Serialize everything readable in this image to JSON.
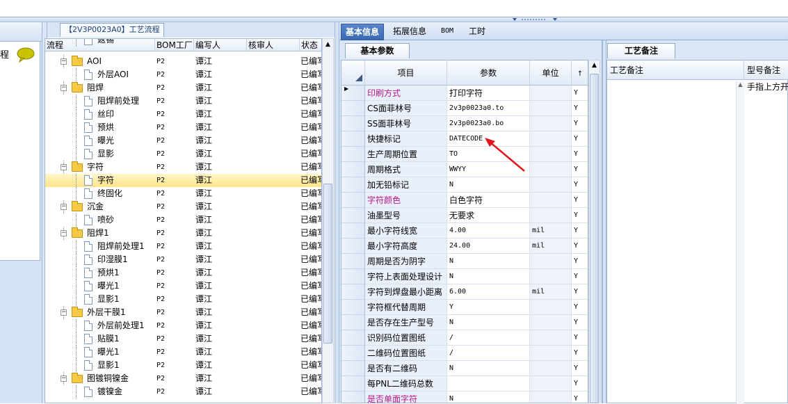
{
  "left_panel": {
    "header_text": "程"
  },
  "tree_panel": {
    "tab_title": "【2V3P0023A0】工艺流程",
    "columns": [
      "流程",
      "BOM工厂",
      "编写人",
      "核审人",
      "状态"
    ],
    "rows": [
      {
        "level": 1,
        "type": "doc",
        "name": "返锡",
        "bom": "",
        "writer": "",
        "reviewer": "",
        "status": ""
      },
      {
        "level": 0,
        "type": "folder",
        "name": "AOI",
        "bom": "P2",
        "writer": "谭江",
        "reviewer": "",
        "status": "已编写"
      },
      {
        "level": 1,
        "type": "doc",
        "name": "外层AOI",
        "bom": "P2",
        "writer": "谭江",
        "reviewer": "",
        "status": "已编写"
      },
      {
        "level": 0,
        "type": "folder",
        "name": "阻焊",
        "bom": "P2",
        "writer": "谭江",
        "reviewer": "",
        "status": "已编写"
      },
      {
        "level": 1,
        "type": "doc",
        "name": "阻焊前处理",
        "bom": "P2",
        "writer": "谭江",
        "reviewer": "",
        "status": "已编写"
      },
      {
        "level": 1,
        "type": "doc",
        "name": "丝印",
        "bom": "P2",
        "writer": "谭江",
        "reviewer": "",
        "status": "已编写"
      },
      {
        "level": 1,
        "type": "doc",
        "name": "预烘",
        "bom": "P2",
        "writer": "谭江",
        "reviewer": "",
        "status": "已编写"
      },
      {
        "level": 1,
        "type": "doc",
        "name": "曝光",
        "bom": "P2",
        "writer": "谭江",
        "reviewer": "",
        "status": "已编写"
      },
      {
        "level": 1,
        "type": "doc",
        "name": "显影",
        "bom": "P2",
        "writer": "谭江",
        "reviewer": "",
        "status": "已编写"
      },
      {
        "level": 0,
        "type": "folder",
        "name": "字符",
        "bom": "P2",
        "writer": "谭江",
        "reviewer": "",
        "status": "已编写"
      },
      {
        "level": 1,
        "type": "doc",
        "name": "字符",
        "bom": "P2",
        "writer": "谭江",
        "reviewer": "",
        "status": "已编写",
        "selected": true
      },
      {
        "level": 1,
        "type": "doc",
        "name": "终固化",
        "bom": "P2",
        "writer": "谭江",
        "reviewer": "",
        "status": "已编写"
      },
      {
        "level": 0,
        "type": "folder",
        "name": "沉金",
        "bom": "P2",
        "writer": "谭江",
        "reviewer": "",
        "status": "已编写"
      },
      {
        "level": 1,
        "type": "doc",
        "name": "喷砂",
        "bom": "P2",
        "writer": "谭江",
        "reviewer": "",
        "status": "已编写"
      },
      {
        "level": 0,
        "type": "folder",
        "name": "阻焊1",
        "bom": "P2",
        "writer": "谭江",
        "reviewer": "",
        "status": "已编写"
      },
      {
        "level": 1,
        "type": "doc",
        "name": "阻焊前处理1",
        "bom": "P2",
        "writer": "谭江",
        "reviewer": "",
        "status": "已编写"
      },
      {
        "level": 1,
        "type": "doc",
        "name": "印湿膜1",
        "bom": "P2",
        "writer": "谭江",
        "reviewer": "",
        "status": "已编写"
      },
      {
        "level": 1,
        "type": "doc",
        "name": "预烘1",
        "bom": "P2",
        "writer": "谭江",
        "reviewer": "",
        "status": "已编写"
      },
      {
        "level": 1,
        "type": "doc",
        "name": "曝光1",
        "bom": "P2",
        "writer": "谭江",
        "reviewer": "",
        "status": "已编写"
      },
      {
        "level": 1,
        "type": "doc",
        "name": "显影1",
        "bom": "P2",
        "writer": "谭江",
        "reviewer": "",
        "status": "已编写"
      },
      {
        "level": 0,
        "type": "folder",
        "name": "外层干膜1",
        "bom": "P2",
        "writer": "谭江",
        "reviewer": "",
        "status": "已编写"
      },
      {
        "level": 1,
        "type": "doc",
        "name": "外层前处理1",
        "bom": "P2",
        "writer": "谭江",
        "reviewer": "",
        "status": "已编写"
      },
      {
        "level": 1,
        "type": "doc",
        "name": "贴膜1",
        "bom": "P2",
        "writer": "谭江",
        "reviewer": "",
        "status": "已编写"
      },
      {
        "level": 1,
        "type": "doc",
        "name": "曝光1",
        "bom": "P2",
        "writer": "谭江",
        "reviewer": "",
        "status": "已编写"
      },
      {
        "level": 1,
        "type": "doc",
        "name": "显影1",
        "bom": "P2",
        "writer": "谭江",
        "reviewer": "",
        "status": "已编写"
      },
      {
        "level": 0,
        "type": "folder",
        "name": "图镀铜镍金",
        "bom": "P2",
        "writer": "谭江",
        "reviewer": "",
        "status": "已编写"
      },
      {
        "level": 1,
        "type": "doc",
        "name": "镀镍金",
        "bom": "P2",
        "writer": "谭江",
        "reviewer": "",
        "status": "已编写"
      }
    ]
  },
  "main_tabs": [
    "基本信息",
    "拓展信息",
    "BOM",
    "工时"
  ],
  "basic_params": {
    "tab_label": "基本参数",
    "columns": [
      "项目",
      "参数",
      "单位",
      ""
    ],
    "rows": [
      {
        "item": "印刷方式",
        "value": "打印字符",
        "unit": "",
        "flag": "Y",
        "highlight": true,
        "current": true
      },
      {
        "item": "CS面菲林号",
        "value": "2v3p0023a0.to",
        "unit": "",
        "flag": "Y"
      },
      {
        "item": "SS面菲林号",
        "value": "2v3p0023a0.bo",
        "unit": "",
        "flag": "Y"
      },
      {
        "item": "快捷标记",
        "value": "DATECODE",
        "unit": "",
        "flag": "Y"
      },
      {
        "item": "生产周期位置",
        "value": "TO",
        "unit": "",
        "flag": "Y"
      },
      {
        "item": "周期格式",
        "value": "WWYY",
        "unit": "",
        "flag": "Y"
      },
      {
        "item": "加无铅标记",
        "value": "N",
        "unit": "",
        "flag": "Y"
      },
      {
        "item": "字符颜色",
        "value": "白色字符",
        "unit": "",
        "flag": "Y",
        "highlight": true
      },
      {
        "item": "油墨型号",
        "value": "无要求",
        "unit": "",
        "flag": "Y"
      },
      {
        "item": "最小字符线宽",
        "value": "4.00",
        "unit": "mil",
        "flag": "Y"
      },
      {
        "item": "最小字符高度",
        "value": "24.00",
        "unit": "mil",
        "flag": "Y"
      },
      {
        "item": "周期是否为阴字",
        "value": "N",
        "unit": "",
        "flag": "Y"
      },
      {
        "item": "字符上表面处理设计",
        "value": "N",
        "unit": "",
        "flag": "Y"
      },
      {
        "item": "字符到焊盘最小距离",
        "value": "6.00",
        "unit": "mil",
        "flag": "Y"
      },
      {
        "item": "字符框代替周期",
        "value": "Y",
        "unit": "",
        "flag": "Y"
      },
      {
        "item": "是否存在生产型号",
        "value": "N",
        "unit": "",
        "flag": "Y"
      },
      {
        "item": "识别码位置图纸",
        "value": "/",
        "unit": "",
        "flag": "Y"
      },
      {
        "item": "二维码位置图纸",
        "value": "/",
        "unit": "",
        "flag": "Y"
      },
      {
        "item": "是否有二维码",
        "value": "N",
        "unit": "",
        "flag": "Y"
      },
      {
        "item": "每PNL二维码总数",
        "value": "",
        "unit": "",
        "flag": "Y"
      },
      {
        "item": "是否单面字符",
        "value": "N",
        "unit": "",
        "flag": "Y",
        "highlight": true
      }
    ]
  },
  "process_remarks": {
    "tab_label": "工艺备注",
    "columns": [
      "工艺备注",
      "型号备注"
    ],
    "model_remark": "手指上方开"
  },
  "colors": {
    "highlight_item": "#b8168c",
    "active_tab": "#3a69b4",
    "selected_row": "#ffe489",
    "arrow": "#e0161c"
  }
}
